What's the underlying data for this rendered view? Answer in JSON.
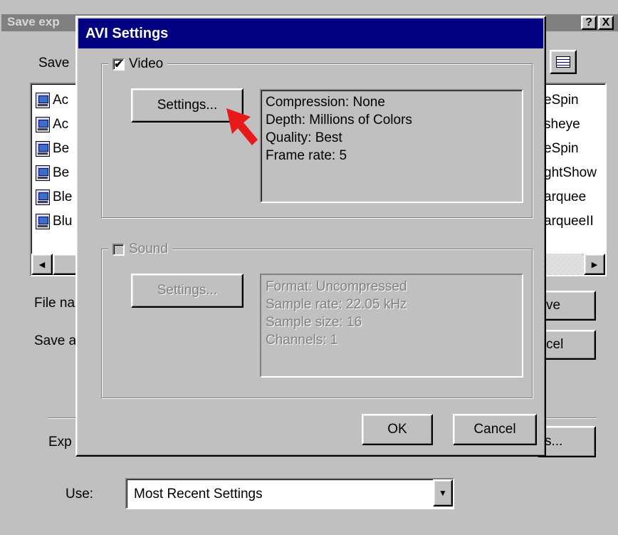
{
  "parent_dialog": {
    "title": "Save exp",
    "help_btn": "?",
    "close_btn": "X",
    "save_in_label": "Save ",
    "list_left": [
      "Ac",
      "Ac",
      "Be",
      "Be",
      "Ble",
      "Blu"
    ],
    "list_right": [
      "eSpin",
      "sheye",
      "eSpin",
      "ghtShow",
      "arquee",
      "arqueeII"
    ],
    "file_name_label": "File na",
    "save_as_label": "Save a",
    "save_button": "ve",
    "cancel_button": "cel",
    "export_label": "Exp",
    "options_button": "s...",
    "use_label": "Use:",
    "use_value": "Most Recent Settings"
  },
  "avi_dialog": {
    "title": "AVI Settings",
    "video": {
      "label": "Video",
      "checked": true,
      "settings_button": "Settings...",
      "info": [
        "Compression: None",
        "Depth: Millions of Colors",
        "Quality: Best",
        "Frame rate: 5"
      ]
    },
    "sound": {
      "label": "Sound",
      "checked": false,
      "settings_button": "Settings...",
      "info": [
        "Format: Uncompressed",
        "Sample rate: 22.05 kHz",
        "Sample size: 16",
        "Channels: 1"
      ]
    },
    "ok_button": "OK",
    "cancel_button": "Cancel"
  },
  "icons": {
    "check": "✔",
    "arrow_left": "◀",
    "arrow_right": "▶",
    "arrow_down": "▼"
  },
  "colors": {
    "face": "#c0c0c0",
    "title_active": "#000080",
    "title_inactive": "#808080",
    "annotation_arrow": "#e8191a"
  }
}
